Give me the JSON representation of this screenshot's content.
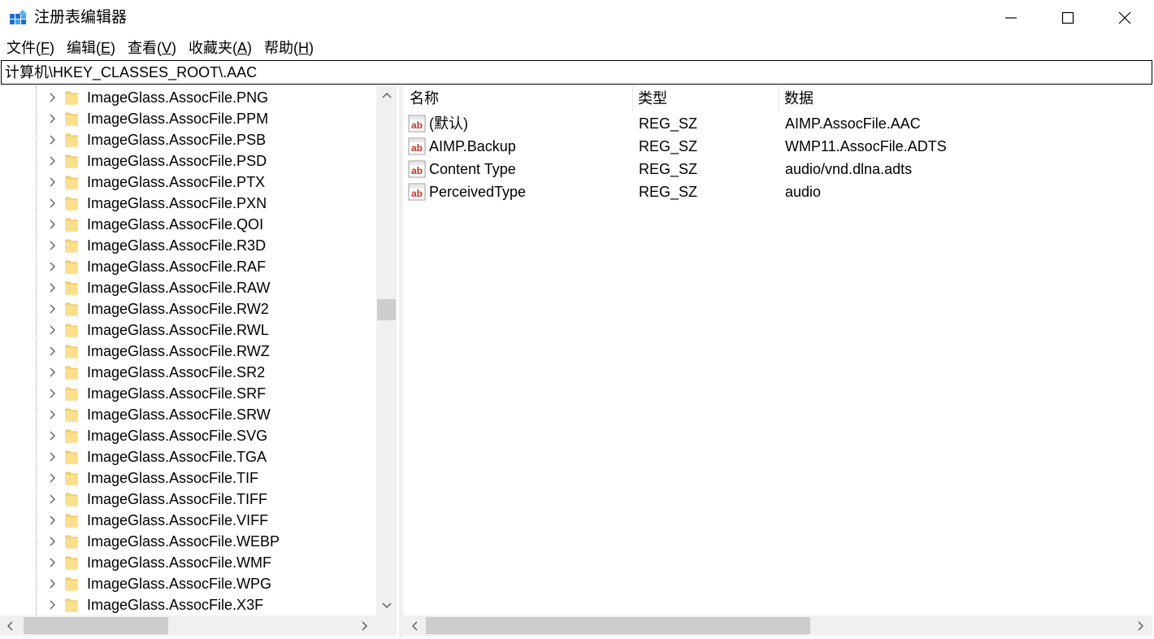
{
  "window": {
    "title": "注册表编辑器",
    "icon": "regedit-icon",
    "controls": [
      "minimize-icon",
      "maximize-icon",
      "close-icon"
    ]
  },
  "menu": [
    {
      "label": "文件(",
      "accel": "F",
      "tail": ")"
    },
    {
      "label": "编辑(",
      "accel": "E",
      "tail": ")"
    },
    {
      "label": "查看(",
      "accel": "V",
      "tail": ")"
    },
    {
      "label": "收藏夹(",
      "accel": "A",
      "tail": ")"
    },
    {
      "label": "帮助(",
      "accel": "H",
      "tail": ")"
    }
  ],
  "address": "计算机\\HKEY_CLASSES_ROOT\\.AAC",
  "tree": {
    "items": [
      "ImageGlass.AssocFile.PNG",
      "ImageGlass.AssocFile.PPM",
      "ImageGlass.AssocFile.PSB",
      "ImageGlass.AssocFile.PSD",
      "ImageGlass.AssocFile.PTX",
      "ImageGlass.AssocFile.PXN",
      "ImageGlass.AssocFile.QOI",
      "ImageGlass.AssocFile.R3D",
      "ImageGlass.AssocFile.RAF",
      "ImageGlass.AssocFile.RAW",
      "ImageGlass.AssocFile.RW2",
      "ImageGlass.AssocFile.RWL",
      "ImageGlass.AssocFile.RWZ",
      "ImageGlass.AssocFile.SR2",
      "ImageGlass.AssocFile.SRF",
      "ImageGlass.AssocFile.SRW",
      "ImageGlass.AssocFile.SVG",
      "ImageGlass.AssocFile.TGA",
      "ImageGlass.AssocFile.TIF",
      "ImageGlass.AssocFile.TIFF",
      "ImageGlass.AssocFile.VIFF",
      "ImageGlass.AssocFile.WEBP",
      "ImageGlass.AssocFile.WMF",
      "ImageGlass.AssocFile.WPG",
      "ImageGlass.AssocFile.X3F"
    ]
  },
  "values": {
    "columns": {
      "name": "名称",
      "type": "类型",
      "data": "数据"
    },
    "rows": [
      {
        "name": "(默认)",
        "type": "REG_SZ",
        "data": "AIMP.AssocFile.AAC"
      },
      {
        "name": "AIMP.Backup",
        "type": "REG_SZ",
        "data": "WMP11.AssocFile.ADTS"
      },
      {
        "name": "Content Type",
        "type": "REG_SZ",
        "data": "audio/vnd.dlna.adts"
      },
      {
        "name": "PerceivedType",
        "type": "REG_SZ",
        "data": "audio"
      }
    ]
  },
  "colors": {
    "folder": "#f7d570",
    "string_icon_red": "#c8342a",
    "scrollbar_track": "#f0f0f0",
    "scrollbar_thumb": "#cdcdcd"
  }
}
